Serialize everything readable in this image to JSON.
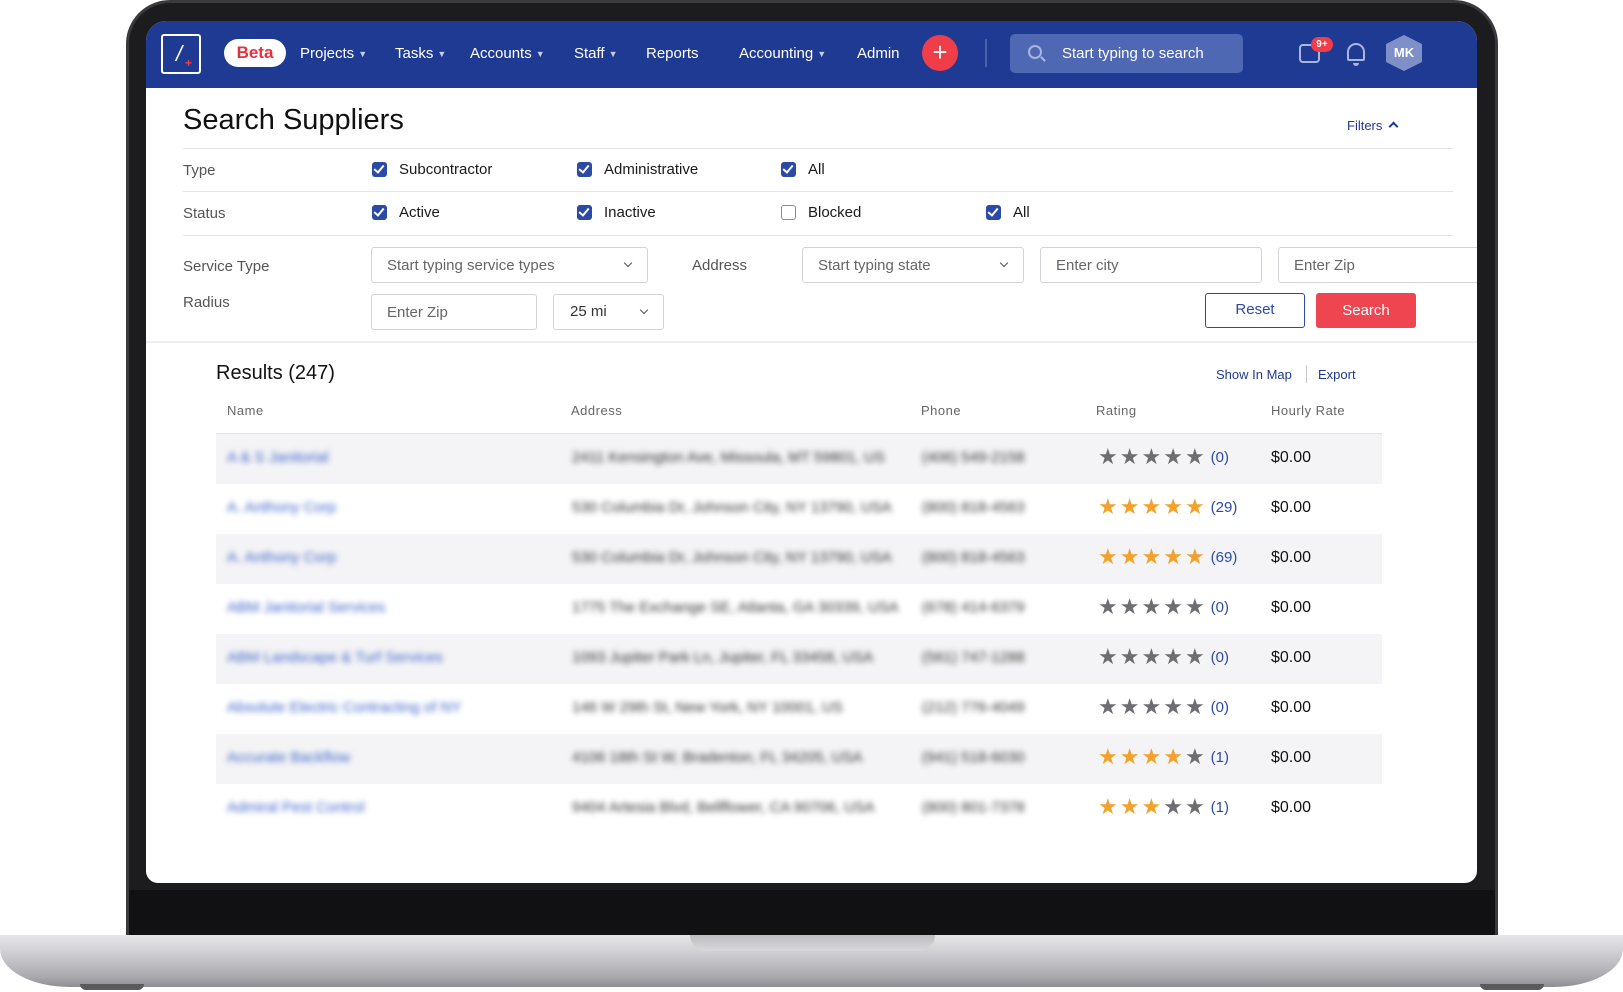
{
  "nav": {
    "beta": "Beta",
    "projects": "Projects",
    "tasks": "Tasks",
    "accounts": "Accounts",
    "staff": "Staff",
    "reports": "Reports",
    "accounting": "Accounting",
    "admin": "Admin",
    "plus": "+",
    "search_placeholder": "Start typing to search",
    "msg_badge": "9+",
    "avatar": "MK"
  },
  "filters": {
    "title": "Search Suppliers",
    "toggle": "Filters",
    "type_label": "Type",
    "type_options": [
      {
        "label": "Subcontractor",
        "checked": true
      },
      {
        "label": "Administrative",
        "checked": true
      },
      {
        "label": "All",
        "checked": true
      }
    ],
    "status_label": "Status",
    "status_options": [
      {
        "label": "Active",
        "checked": true
      },
      {
        "label": "Inactive",
        "checked": true
      },
      {
        "label": "Blocked",
        "checked": false
      },
      {
        "label": "All",
        "checked": true
      }
    ],
    "service_type_label": "Service Type",
    "service_type_placeholder": "Start typing service types",
    "address_label": "Address",
    "state_placeholder": "Start typing state",
    "city_placeholder": "Enter city",
    "zip_placeholder": "Enter Zip",
    "radius_label": "Radius",
    "radius_zip_placeholder": "Enter Zip",
    "radius_value": "25 mi",
    "reset": "Reset",
    "search": "Search"
  },
  "results": {
    "title": "Results (247)",
    "show_in_map": "Show In Map",
    "export": "Export",
    "columns": [
      "Name",
      "Address",
      "Phone",
      "Rating",
      "Hourly Rate"
    ],
    "rows": [
      {
        "name": "A & S Janitorial",
        "address": "2411 Kensington Ave, Missoula, MT 59801, US",
        "phone": "(406) 549-2158",
        "stars": 0,
        "count": "(0)",
        "rate": "$0.00"
      },
      {
        "name": "A. Anthony Corp",
        "address": "530 Columbia Dr, Johnson City, NY 13790, USA",
        "phone": "(800) 818-4563",
        "stars": 5,
        "count": "(29)",
        "rate": "$0.00"
      },
      {
        "name": "A. Anthony Corp",
        "address": "530 Columbia Dr, Johnson City, NY 13790, USA",
        "phone": "(800) 818-4563",
        "stars": 5,
        "count": "(69)",
        "rate": "$0.00"
      },
      {
        "name": "ABM Janitorial Services",
        "address": "1775 The Exchange SE, Atlanta, GA 30339, USA",
        "phone": "(678) 414-6379",
        "stars": 0,
        "count": "(0)",
        "rate": "$0.00"
      },
      {
        "name": "ABM Landscape & Turf Services",
        "address": "1093 Jupiter Park Ln, Jupiter, FL 33458, USA",
        "phone": "(561) 747-1288",
        "stars": 0,
        "count": "(0)",
        "rate": "$0.00"
      },
      {
        "name": "Absolute Electric Contracting of NY",
        "address": "146 W 29th St, New York, NY 10001, US",
        "phone": "(212) 776-4049",
        "stars": 0,
        "count": "(0)",
        "rate": "$0.00"
      },
      {
        "name": "Accurate Backflow",
        "address": "4106 18th St W, Bradenton, FL 34205, USA",
        "phone": "(941) 518-6030",
        "stars": 4,
        "count": "(1)",
        "rate": "$0.00"
      },
      {
        "name": "Admiral Pest Control",
        "address": "9404 Artesia Blvd, Bellflower, CA 90706, USA",
        "phone": "(800) 801-7378",
        "stars": 3,
        "count": "(1)",
        "rate": "$0.00"
      }
    ]
  }
}
